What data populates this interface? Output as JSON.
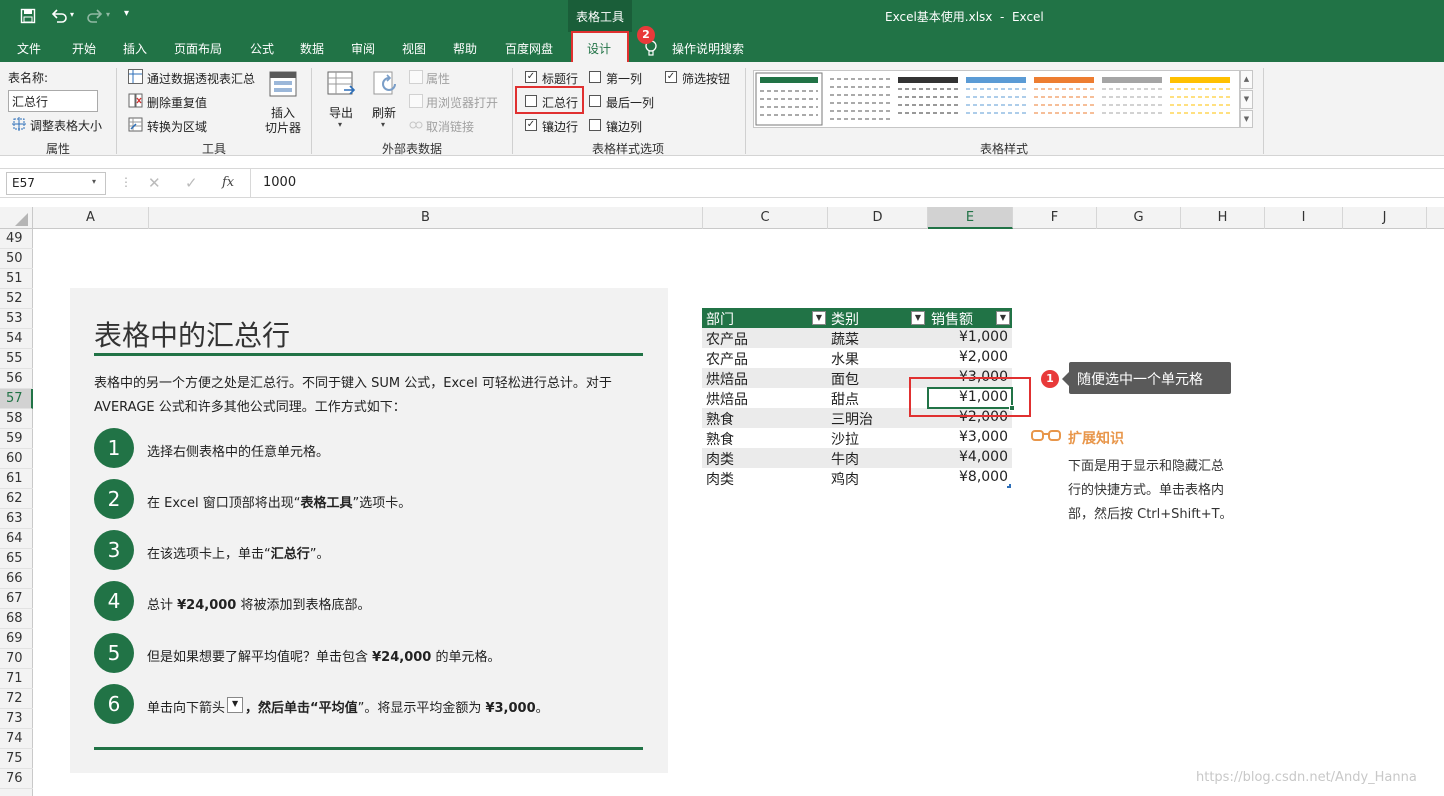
{
  "app": {
    "context_tab_group": "表格工具",
    "window_title": "Excel基本使用.xlsx  -  Excel"
  },
  "tabs": [
    "文件",
    "开始",
    "插入",
    "页面布局",
    "公式",
    "数据",
    "审阅",
    "视图",
    "帮助",
    "百度网盘",
    "设计",
    "操作说明搜索"
  ],
  "ribbon": {
    "properties": {
      "label": "表名称:",
      "table_name": "汇总行",
      "resize": "调整表格大小",
      "group": "属性"
    },
    "tools": {
      "pivot": "通过数据透视表汇总",
      "remove_dup": "删除重复值",
      "convert": "转换为区域",
      "slicer_line1": "插入",
      "slicer_line2": "切片器",
      "group": "工具"
    },
    "external": {
      "export": "导出",
      "refresh": "刷新",
      "properties": "属性",
      "open_browser": "用浏览器打开",
      "unlink": "取消链接",
      "group": "外部表数据"
    },
    "style_options": {
      "header_row": {
        "label": "标题行",
        "checked": true
      },
      "total_row": {
        "label": "汇总行",
        "checked": false
      },
      "banded_rows": {
        "label": "镶边行",
        "checked": true
      },
      "first_column": {
        "label": "第一列",
        "checked": false
      },
      "last_column": {
        "label": "最后一列",
        "checked": false
      },
      "banded_columns": {
        "label": "镶边列",
        "checked": false
      },
      "filter_button": {
        "label": "筛选按钮",
        "checked": true
      },
      "group": "表格样式选项"
    },
    "table_styles": {
      "group": "表格样式"
    }
  },
  "formula_bar": {
    "name_box": "E57",
    "fx": "fx",
    "value": "1000"
  },
  "columns": [
    "A",
    "B",
    "C",
    "D",
    "E",
    "F",
    "G",
    "H",
    "I",
    "J"
  ],
  "rows": [
    "49",
    "50",
    "51",
    "52",
    "53",
    "54",
    "55",
    "56",
    "57",
    "58",
    "59",
    "60",
    "61",
    "62",
    "63",
    "64",
    "65",
    "66",
    "67",
    "68",
    "69",
    "70",
    "71",
    "72",
    "73",
    "74",
    "75",
    "76"
  ],
  "panel": {
    "title": "表格中的汇总行",
    "intro_line1": "表格中的另一个方便之处是汇总行。不同于键入 SUM 公式，Excel 可轻松进行总计。对于",
    "intro_line2": "AVERAGE 公式和许多其他公式同理。工作方式如下：",
    "steps": [
      {
        "num": "1",
        "text": "选择右侧表格中的任意单元格。"
      },
      {
        "num": "2",
        "pre": "在 Excel 窗口顶部将出现“",
        "bold": "表格工具",
        "post": "”选项卡。"
      },
      {
        "num": "3",
        "pre": "在该选项卡上，单击“",
        "bold": "汇总行",
        "post": "”。"
      },
      {
        "num": "4",
        "pre": "总计 ",
        "bold": "¥24,000",
        "post": " 将被添加到表格底部。"
      },
      {
        "num": "5",
        "pre": "但是如果想要了解平均值呢？单击包含 ",
        "bold": "¥24,000",
        "post": " 的单元格。"
      },
      {
        "num": "6",
        "pre": "单击向下箭头",
        "mid": "，然后单击“",
        "bold": "平均值",
        "post": "”。将显示平均金额为 ",
        "bold2": "¥3,000",
        "end": "。"
      }
    ]
  },
  "table": {
    "headers": [
      "部门",
      "类别",
      "销售额"
    ],
    "rows": [
      [
        "农产品",
        "蔬菜",
        "¥1,000"
      ],
      [
        "农产品",
        "水果",
        "¥2,000"
      ],
      [
        "烘焙品",
        "面包",
        "¥3,000"
      ],
      [
        "烘焙品",
        "甜点",
        "¥1,000"
      ],
      [
        "熟食",
        "三明治",
        "¥2,000"
      ],
      [
        "熟食",
        "沙拉",
        "¥3,000"
      ],
      [
        "肉类",
        "牛肉",
        "¥4,000"
      ],
      [
        "肉类",
        "鸡肉",
        "¥8,000"
      ]
    ]
  },
  "annotations": {
    "badge1": "1",
    "badge2": "2",
    "callout": "随便选中一个单元格",
    "tip_title": "扩展知识",
    "tip_line1": "下面是用于显示和隐藏汇总",
    "tip_line2": "行的快捷方式。单击表格内",
    "tip_line3": "部，然后按 Ctrl+Shift+T。"
  },
  "watermark": "https://blog.csdn.net/Andy_Hanna",
  "colors": {
    "excel_green": "#217346",
    "annotation_red": "#e03030",
    "callout_bg": "#5a5a5a",
    "tip_orange": "#e8964a"
  }
}
